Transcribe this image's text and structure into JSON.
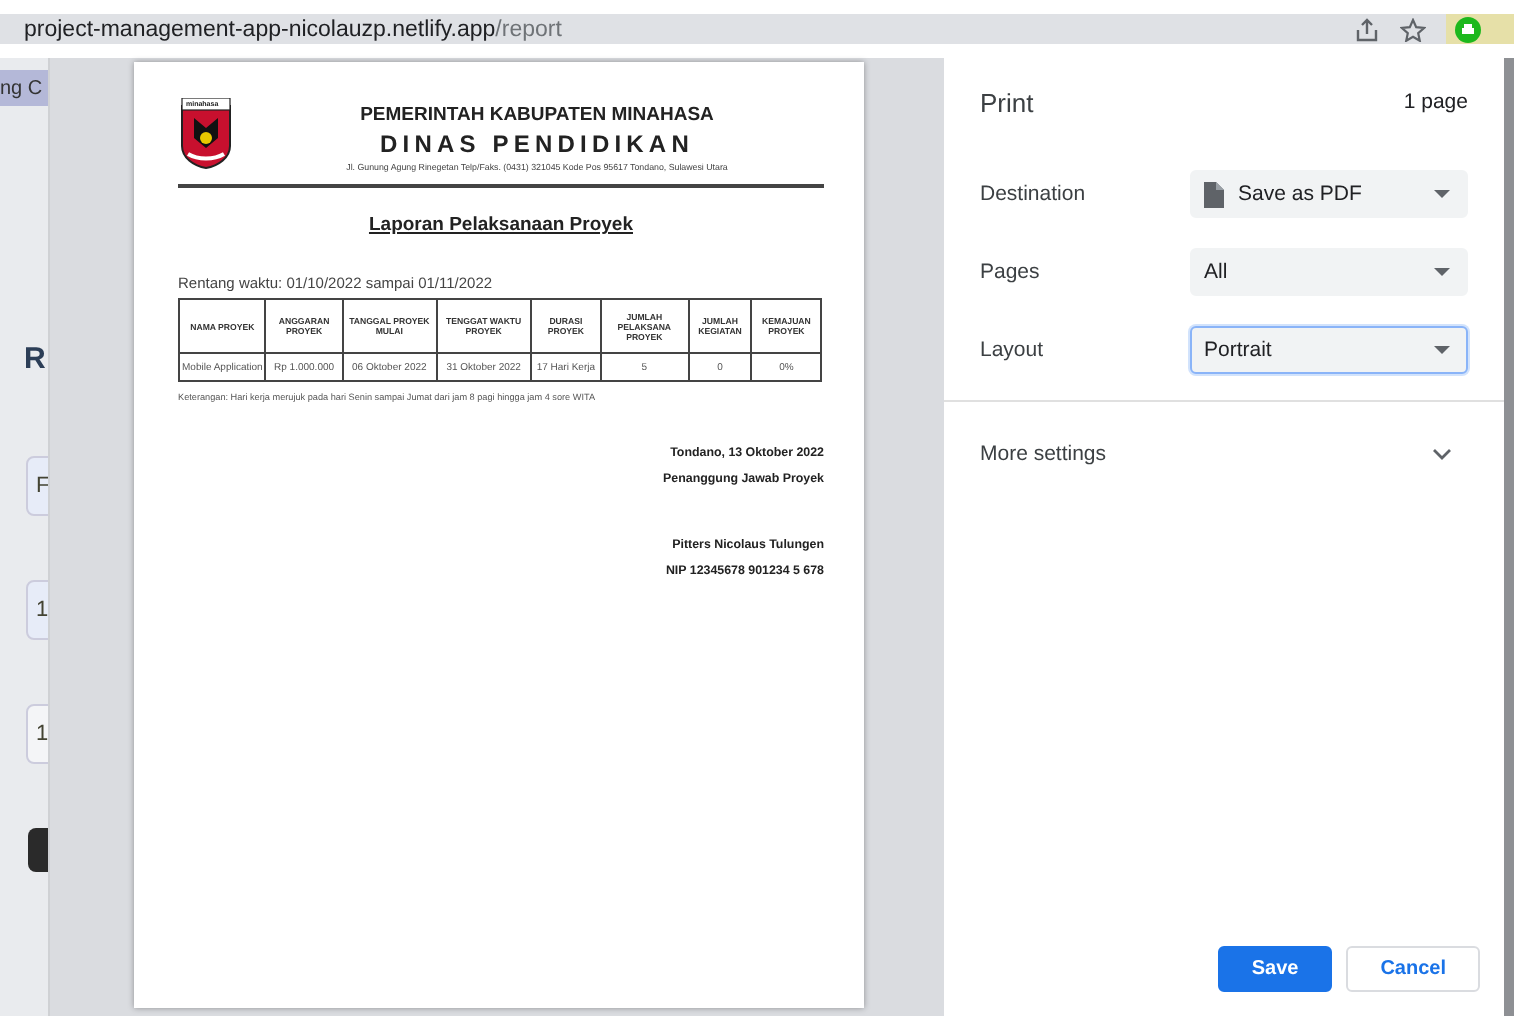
{
  "browser": {
    "url_host": "project-management-app-nicolauzp.netlify.app",
    "url_path": "/report"
  },
  "background_page": {
    "tab_text": "ng C",
    "heading": "R",
    "field_values": [
      "F",
      "1",
      "1"
    ]
  },
  "print_preview": {
    "header": {
      "logo_text": "minahasa",
      "line1": "PEMERINTAH KABUPATEN MINAHASA",
      "line2": "DINAS PENDIDIKAN",
      "address": "Jl. Gunung Agung Rinegetan Telp/Faks. (0431) 321045 Kode Pos 95617 Tondano, Sulawesi Utara"
    },
    "title": "Laporan Pelaksanaan Proyek",
    "period": "Rentang waktu: 01/10/2022 sampai 01/11/2022",
    "table": {
      "columns": [
        "NAMA PROYEK",
        "ANGGARAN PROYEK",
        "TANGGAL PROYEK MULAI",
        "TENGGAT WAKTU PROYEK",
        "DURASI PROYEK",
        "JUMLAH PELAKSANA PROYEK",
        "JUMLAH KEGIATAN",
        "KEMAJUAN PROYEK"
      ],
      "rows": [
        [
          "Mobile Application",
          "Rp 1.000.000",
          "06 Oktober 2022",
          "31 Oktober 2022",
          "17 Hari Kerja",
          "5",
          "0",
          "0%"
        ]
      ]
    },
    "note": "Keterangan: Hari kerja merujuk pada hari Senin sampai Jumat dari jam 8 pagi hingga jam 4 sore WITA",
    "signature": {
      "place_date": "Tondano, 13 Oktober 2022",
      "role": "Penanggung Jawab Proyek",
      "name": "Pitters Nicolaus Tulungen",
      "nip": "NIP 12345678 901234 5 678"
    }
  },
  "print_panel": {
    "title": "Print",
    "page_count": "1 page",
    "settings": [
      {
        "label": "Destination",
        "value": "Save as PDF",
        "kind": "destination",
        "focused": false
      },
      {
        "label": "Pages",
        "value": "All",
        "kind": "select",
        "focused": false
      },
      {
        "label": "Layout",
        "value": "Portrait",
        "kind": "select",
        "focused": true
      }
    ],
    "more_settings": {
      "label": "More settings",
      "expanded": false
    },
    "buttons": [
      {
        "label": "Save",
        "kind": "primary"
      },
      {
        "label": "Cancel",
        "kind": "secondary"
      }
    ]
  }
}
